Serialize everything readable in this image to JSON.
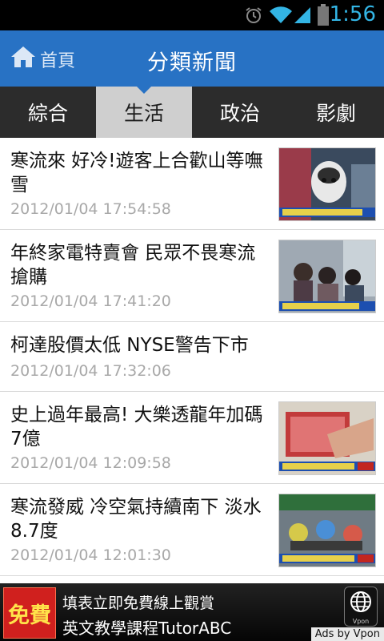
{
  "status_bar": {
    "time": "1:56"
  },
  "app_bar": {
    "home_label": "首頁",
    "title": "分類新聞"
  },
  "tabs": [
    {
      "label": "綜合",
      "active": false
    },
    {
      "label": "生活",
      "active": true
    },
    {
      "label": "政治",
      "active": false
    },
    {
      "label": "影劇",
      "active": false
    }
  ],
  "news": [
    {
      "title": "寒流來 好冷!遊客上合歡山等嘸雪",
      "date": "2012/01/04 17:54:58",
      "thumbnail": "dog-on-snow-news-clip"
    },
    {
      "title": "年終家電特賣會 民眾不畏寒流搶購",
      "date": "2012/01/04 17:41:20",
      "thumbnail": "appliance-sale-crowd-clip"
    },
    {
      "title": "柯達股價太低 NYSE警告下市",
      "date": "2012/01/04 17:32:06",
      "thumbnail": ""
    },
    {
      "title": "史上過年最高! 大樂透龍年加碼7億",
      "date": "2012/01/04 12:09:58",
      "thumbnail": "lottery-ticket-clip"
    },
    {
      "title": "寒流發威 冷空氣持續南下 淡水8.7度",
      "date": "2012/01/04 12:01:30",
      "thumbnail": "scooter-rain-clip"
    }
  ],
  "ad": {
    "badge": "免費",
    "line1": "填表立即免費線上觀賞",
    "line2": "英文教學課程TutorABC",
    "logo_label": "Vpon",
    "ads_by": "Ads by Vpon"
  },
  "colors": {
    "app_bar": "#2872c4",
    "tab_bar": "#2c2c2c",
    "tab_active": "#cfcfcf",
    "date": "#a8a8a8",
    "status_accent": "#33b5e5"
  }
}
